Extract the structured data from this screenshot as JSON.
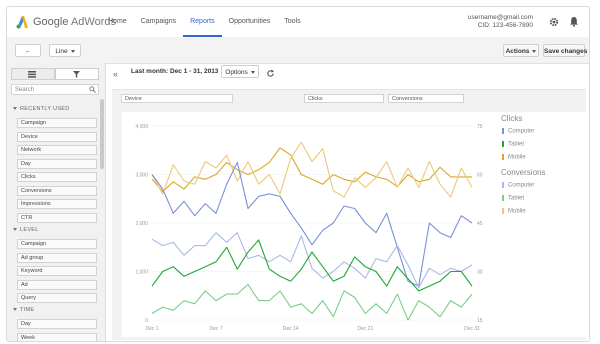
{
  "header": {
    "brand_google": "Google",
    "brand_product": "AdWords",
    "nav": [
      "Home",
      "Campaigns",
      "Reports",
      "Opportunities",
      "Tools"
    ],
    "active_nav": "Reports",
    "account_email": "username@gmail.com",
    "account_cid": "CID: 123-456-7890"
  },
  "toolbar": {
    "back_icon": "back-arrow-icon",
    "chart_type": "Line",
    "actions_label": "Actions",
    "save_label": "Save changes"
  },
  "sidebar": {
    "search_placeholder": "Search",
    "sections": [
      {
        "title": "RECENTLY USED",
        "items": [
          "Campaign",
          "Device",
          "Network",
          "Day",
          "Clicks",
          "Conversions",
          "Impressions",
          "CTR"
        ]
      },
      {
        "title": "LEVEL",
        "items": [
          "Campaign",
          "Ad group",
          "Keyword",
          "Ad",
          "Query"
        ]
      },
      {
        "title": "TIME",
        "items": [
          "Day",
          "Week"
        ]
      }
    ]
  },
  "main": {
    "date_range": "Last month: Dec 1 - 31, 2013",
    "options_label": "Options",
    "drop_row": "Device",
    "drop_metric_1": "Clicks",
    "drop_metric_2": "Conversions"
  },
  "legend": {
    "groups": [
      {
        "title": "Clicks",
        "items": [
          {
            "name": "Computer",
            "color": "#7b90d8"
          },
          {
            "name": "Tablet",
            "color": "#1ea832"
          },
          {
            "name": "Mobile",
            "color": "#d9a72a"
          }
        ]
      },
      {
        "title": "Conversions",
        "items": [
          {
            "name": "Computer",
            "color": "#a9b8ea"
          },
          {
            "name": "Tablet",
            "color": "#79cf86"
          },
          {
            "name": "Mobile",
            "color": "#ecc978"
          }
        ]
      }
    ]
  },
  "chart_data": {
    "type": "line",
    "x": [
      "Dec 1",
      "Dec 2",
      "Dec 3",
      "Dec 4",
      "Dec 5",
      "Dec 6",
      "Dec 7",
      "Dec 8",
      "Dec 9",
      "Dec 10",
      "Dec 11",
      "Dec 12",
      "Dec 13",
      "Dec 14",
      "Dec 15",
      "Dec 16",
      "Dec 17",
      "Dec 18",
      "Dec 19",
      "Dec 20",
      "Dec 21",
      "Dec 22",
      "Dec 23",
      "Dec 24",
      "Dec 25",
      "Dec 26",
      "Dec 27",
      "Dec 28",
      "Dec 29",
      "Dec 30",
      "Dec 31"
    ],
    "x_tick_labels": [
      "Dec 1",
      "Dec 7",
      "Dec 14",
      "Dec 21",
      "Dec 31"
    ],
    "y_left": {
      "ticks": [
        "0",
        "1,000",
        "2,000",
        "3,000",
        "4,000"
      ],
      "ylim": [
        0,
        4000
      ]
    },
    "y_right": {
      "ticks": [
        "15",
        "30",
        "45",
        "60",
        "75"
      ],
      "ylim": [
        15,
        75
      ]
    },
    "series": [
      {
        "name": "Clicks - Mobile",
        "axis": "left",
        "color": "#d9a72a",
        "values": [
          2900,
          2650,
          2850,
          2700,
          2950,
          2900,
          3000,
          3250,
          3100,
          3000,
          3100,
          3250,
          3550,
          3400,
          3000,
          2900,
          2800,
          3000,
          2900,
          2850,
          3050,
          2950,
          2900,
          2750,
          3000,
          2850,
          2900,
          3150,
          2950,
          2950,
          2950
        ]
      },
      {
        "name": "Conversions - Mobile",
        "axis": "right",
        "color": "#ecc978",
        "values": [
          60,
          54,
          63,
          58,
          57,
          64,
          62,
          66,
          58,
          64,
          57,
          60,
          54,
          65,
          70,
          64,
          68,
          55,
          53,
          59,
          56,
          59,
          64,
          56,
          62,
          56,
          64,
          57,
          53,
          62,
          56
        ]
      },
      {
        "name": "Clicks - Computer",
        "axis": "left",
        "color": "#7b90d8",
        "values": [
          3000,
          2700,
          2200,
          2450,
          2150,
          2400,
          2200,
          2800,
          3250,
          2300,
          2550,
          2600,
          2550,
          2200,
          1900,
          1550,
          1850,
          2000,
          2350,
          2300,
          2000,
          1800,
          2200,
          1500,
          800,
          700,
          2000,
          1800,
          1700,
          2150,
          2000
        ]
      },
      {
        "name": "Conversions - Computer",
        "axis": "right",
        "color": "#a9b8ea",
        "values": [
          40,
          38,
          39,
          35,
          38,
          38,
          42,
          39,
          42,
          34,
          35,
          33,
          35,
          33,
          41,
          31,
          28,
          30,
          33,
          31,
          28,
          34,
          33,
          38,
          32,
          25,
          31,
          29,
          31,
          30,
          32
        ]
      },
      {
        "name": "Clicks - Tablet",
        "axis": "left",
        "color": "#1ea832",
        "values": [
          700,
          1000,
          1100,
          900,
          1000,
          1100,
          1200,
          1500,
          1050,
          1400,
          1650,
          1050,
          900,
          800,
          1050,
          1400,
          1100,
          800,
          900,
          1300,
          1100,
          1000,
          700,
          1100,
          850,
          600,
          700,
          800,
          1000,
          1000,
          700
        ]
      },
      {
        "name": "Conversions - Tablet",
        "axis": "right",
        "color": "#79cf86",
        "values": [
          17,
          19,
          18,
          21,
          20,
          24,
          21,
          23,
          23,
          26,
          21,
          21,
          24,
          19,
          20,
          17,
          21,
          16,
          24,
          22,
          17,
          20,
          17,
          23,
          15,
          21,
          19,
          16,
          21,
          19,
          23
        ]
      }
    ]
  }
}
